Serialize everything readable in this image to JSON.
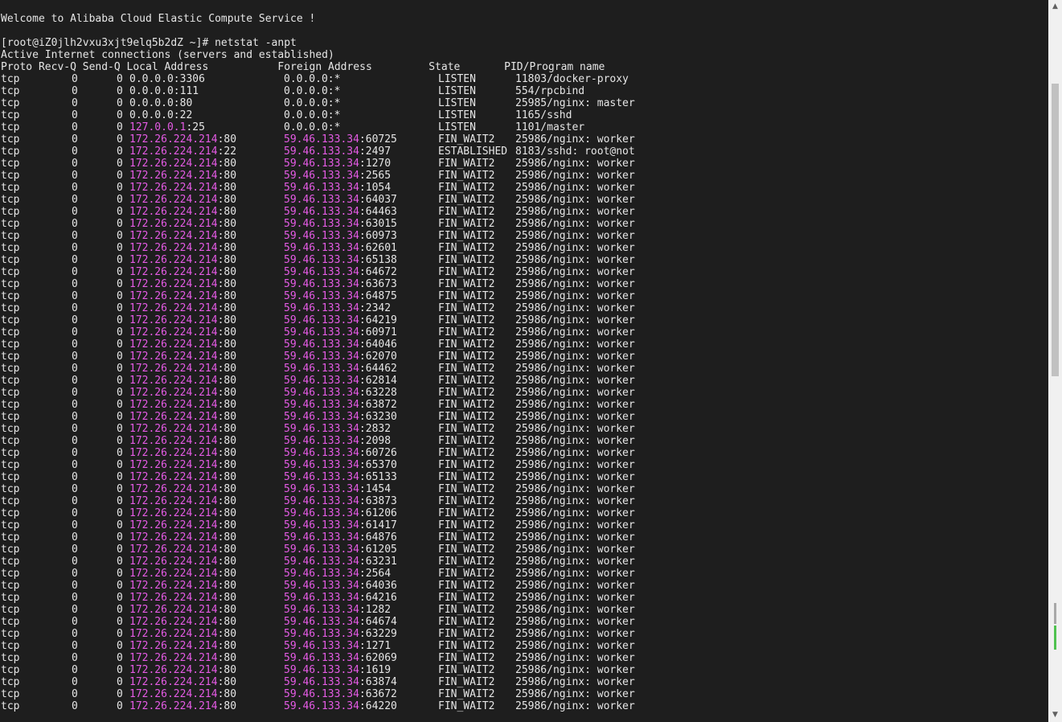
{
  "terminal": {
    "welcome": "Welcome to Alibaba Cloud Elastic Compute Service !",
    "prompt": "[root@iZ0jlh2vxu3xjt9elq5b2dZ ~]# netstat -anpt",
    "heading": "Active Internet connections (servers and established)",
    "columns": [
      "Proto",
      "Recv-Q",
      "Send-Q",
      "Local Address",
      "Foreign Address",
      "State",
      "PID/Program name"
    ],
    "header_line": "Proto Recv-Q Send-Q Local Address           Foreign Address         State       PID/Program name",
    "listen_rows": [
      {
        "proto": "tcp",
        "recv": "0",
        "send": "0",
        "local_ip": "0.0.0.0",
        "local_port": ":3306",
        "foreign": "0.0.0.0:*",
        "state": "LISTEN",
        "program": "11803/docker-proxy",
        "highlight": false
      },
      {
        "proto": "tcp",
        "recv": "0",
        "send": "0",
        "local_ip": "0.0.0.0",
        "local_port": ":111",
        "foreign": "0.0.0.0:*",
        "state": "LISTEN",
        "program": "554/rpcbind",
        "highlight": false
      },
      {
        "proto": "tcp",
        "recv": "0",
        "send": "0",
        "local_ip": "0.0.0.0",
        "local_port": ":80",
        "foreign": "0.0.0.0:*",
        "state": "LISTEN",
        "program": "25985/nginx: master",
        "highlight": false
      },
      {
        "proto": "tcp",
        "recv": "0",
        "send": "0",
        "local_ip": "0.0.0.0",
        "local_port": ":22",
        "foreign": "0.0.0.0:*",
        "state": "LISTEN",
        "program": "1165/sshd",
        "highlight": false
      },
      {
        "proto": "tcp",
        "recv": "0",
        "send": "0",
        "local_ip": "127.0.0.1",
        "local_port": ":25",
        "foreign": "0.0.0.0:*",
        "state": "LISTEN",
        "program": "1101/master",
        "highlight": true
      }
    ],
    "conn_local_ip": "172.26.224.214",
    "conn_foreign_ip": "59.46.133.34",
    "conn_rows": [
      {
        "local_port": ":80",
        "foreign_port": ":60725",
        "state": "FIN_WAIT2",
        "program": "25986/nginx: worker"
      },
      {
        "local_port": ":22",
        "foreign_port": ":2497",
        "state": "ESTABLISHED",
        "program": "8183/sshd: root@not"
      },
      {
        "local_port": ":80",
        "foreign_port": ":1270",
        "state": "FIN_WAIT2",
        "program": "25986/nginx: worker"
      },
      {
        "local_port": ":80",
        "foreign_port": ":2565",
        "state": "FIN_WAIT2",
        "program": "25986/nginx: worker"
      },
      {
        "local_port": ":80",
        "foreign_port": ":1054",
        "state": "FIN_WAIT2",
        "program": "25986/nginx: worker"
      },
      {
        "local_port": ":80",
        "foreign_port": ":64037",
        "state": "FIN_WAIT2",
        "program": "25986/nginx: worker"
      },
      {
        "local_port": ":80",
        "foreign_port": ":64463",
        "state": "FIN_WAIT2",
        "program": "25986/nginx: worker"
      },
      {
        "local_port": ":80",
        "foreign_port": ":63015",
        "state": "FIN_WAIT2",
        "program": "25986/nginx: worker"
      },
      {
        "local_port": ":80",
        "foreign_port": ":60973",
        "state": "FIN_WAIT2",
        "program": "25986/nginx: worker"
      },
      {
        "local_port": ":80",
        "foreign_port": ":62601",
        "state": "FIN_WAIT2",
        "program": "25986/nginx: worker"
      },
      {
        "local_port": ":80",
        "foreign_port": ":65138",
        "state": "FIN_WAIT2",
        "program": "25986/nginx: worker"
      },
      {
        "local_port": ":80",
        "foreign_port": ":64672",
        "state": "FIN_WAIT2",
        "program": "25986/nginx: worker"
      },
      {
        "local_port": ":80",
        "foreign_port": ":63673",
        "state": "FIN_WAIT2",
        "program": "25986/nginx: worker"
      },
      {
        "local_port": ":80",
        "foreign_port": ":64875",
        "state": "FIN_WAIT2",
        "program": "25986/nginx: worker"
      },
      {
        "local_port": ":80",
        "foreign_port": ":2342",
        "state": "FIN_WAIT2",
        "program": "25986/nginx: worker"
      },
      {
        "local_port": ":80",
        "foreign_port": ":64219",
        "state": "FIN_WAIT2",
        "program": "25986/nginx: worker"
      },
      {
        "local_port": ":80",
        "foreign_port": ":60971",
        "state": "FIN_WAIT2",
        "program": "25986/nginx: worker"
      },
      {
        "local_port": ":80",
        "foreign_port": ":64046",
        "state": "FIN_WAIT2",
        "program": "25986/nginx: worker"
      },
      {
        "local_port": ":80",
        "foreign_port": ":62070",
        "state": "FIN_WAIT2",
        "program": "25986/nginx: worker"
      },
      {
        "local_port": ":80",
        "foreign_port": ":64462",
        "state": "FIN_WAIT2",
        "program": "25986/nginx: worker"
      },
      {
        "local_port": ":80",
        "foreign_port": ":62814",
        "state": "FIN_WAIT2",
        "program": "25986/nginx: worker"
      },
      {
        "local_port": ":80",
        "foreign_port": ":63228",
        "state": "FIN_WAIT2",
        "program": "25986/nginx: worker"
      },
      {
        "local_port": ":80",
        "foreign_port": ":63872",
        "state": "FIN_WAIT2",
        "program": "25986/nginx: worker"
      },
      {
        "local_port": ":80",
        "foreign_port": ":63230",
        "state": "FIN_WAIT2",
        "program": "25986/nginx: worker"
      },
      {
        "local_port": ":80",
        "foreign_port": ":2832",
        "state": "FIN_WAIT2",
        "program": "25986/nginx: worker"
      },
      {
        "local_port": ":80",
        "foreign_port": ":2098",
        "state": "FIN_WAIT2",
        "program": "25986/nginx: worker"
      },
      {
        "local_port": ":80",
        "foreign_port": ":60726",
        "state": "FIN_WAIT2",
        "program": "25986/nginx: worker"
      },
      {
        "local_port": ":80",
        "foreign_port": ":65370",
        "state": "FIN_WAIT2",
        "program": "25986/nginx: worker"
      },
      {
        "local_port": ":80",
        "foreign_port": ":65133",
        "state": "FIN_WAIT2",
        "program": "25986/nginx: worker"
      },
      {
        "local_port": ":80",
        "foreign_port": ":1454",
        "state": "FIN_WAIT2",
        "program": "25986/nginx: worker"
      },
      {
        "local_port": ":80",
        "foreign_port": ":63873",
        "state": "FIN_WAIT2",
        "program": "25986/nginx: worker"
      },
      {
        "local_port": ":80",
        "foreign_port": ":61206",
        "state": "FIN_WAIT2",
        "program": "25986/nginx: worker"
      },
      {
        "local_port": ":80",
        "foreign_port": ":61417",
        "state": "FIN_WAIT2",
        "program": "25986/nginx: worker"
      },
      {
        "local_port": ":80",
        "foreign_port": ":64876",
        "state": "FIN_WAIT2",
        "program": "25986/nginx: worker"
      },
      {
        "local_port": ":80",
        "foreign_port": ":61205",
        "state": "FIN_WAIT2",
        "program": "25986/nginx: worker"
      },
      {
        "local_port": ":80",
        "foreign_port": ":63231",
        "state": "FIN_WAIT2",
        "program": "25986/nginx: worker"
      },
      {
        "local_port": ":80",
        "foreign_port": ":2564",
        "state": "FIN_WAIT2",
        "program": "25986/nginx: worker"
      },
      {
        "local_port": ":80",
        "foreign_port": ":64036",
        "state": "FIN_WAIT2",
        "program": "25986/nginx: worker"
      },
      {
        "local_port": ":80",
        "foreign_port": ":64216",
        "state": "FIN_WAIT2",
        "program": "25986/nginx: worker"
      },
      {
        "local_port": ":80",
        "foreign_port": ":1282",
        "state": "FIN_WAIT2",
        "program": "25986/nginx: worker"
      },
      {
        "local_port": ":80",
        "foreign_port": ":64674",
        "state": "FIN_WAIT2",
        "program": "25986/nginx: worker"
      },
      {
        "local_port": ":80",
        "foreign_port": ":63229",
        "state": "FIN_WAIT2",
        "program": "25986/nginx: worker"
      },
      {
        "local_port": ":80",
        "foreign_port": ":1271",
        "state": "FIN_WAIT2",
        "program": "25986/nginx: worker"
      },
      {
        "local_port": ":80",
        "foreign_port": ":62069",
        "state": "FIN_WAIT2",
        "program": "25986/nginx: worker"
      },
      {
        "local_port": ":80",
        "foreign_port": ":1619",
        "state": "FIN_WAIT2",
        "program": "25986/nginx: worker"
      },
      {
        "local_port": ":80",
        "foreign_port": ":63874",
        "state": "FIN_WAIT2",
        "program": "25986/nginx: worker"
      },
      {
        "local_port": ":80",
        "foreign_port": ":63672",
        "state": "FIN_WAIT2",
        "program": "25986/nginx: worker"
      },
      {
        "local_port": ":80",
        "foreign_port": ":64220",
        "state": "FIN_WAIT2",
        "program": "25986/nginx: worker"
      }
    ]
  },
  "colors": {
    "background": "#1e1e1e",
    "text": "#e6e6e6",
    "ip_highlight": "#e55be5"
  },
  "scrollbar": {
    "up_icon": "triangle-up-icon",
    "down_icon": "triangle-down-icon",
    "up_glyph": "▲",
    "down_glyph": "▼"
  }
}
